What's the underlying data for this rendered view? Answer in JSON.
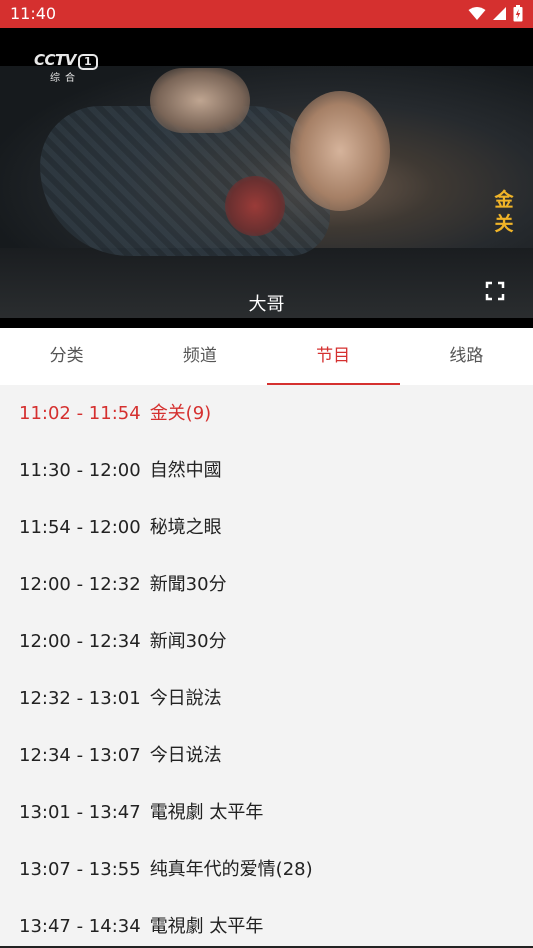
{
  "status_bar": {
    "time": "11:40",
    "background": "#d5302f"
  },
  "player": {
    "channel_logo": {
      "word": "CCTV",
      "number": "1",
      "sub": "综合"
    },
    "overlay_title": [
      "金",
      "关"
    ],
    "caption": "大哥"
  },
  "tabs": [
    {
      "label": "分类",
      "active": false
    },
    {
      "label": "频道",
      "active": false
    },
    {
      "label": "节目",
      "active": true
    },
    {
      "label": "线路",
      "active": false
    }
  ],
  "programs": [
    {
      "time": "11:02 - 11:54",
      "title": "金关(9)",
      "current": true
    },
    {
      "time": "11:30 - 12:00",
      "title": "自然中國",
      "current": false
    },
    {
      "time": "11:54 - 12:00",
      "title": "秘境之眼",
      "current": false
    },
    {
      "time": "12:00 - 12:32",
      "title": "新聞30分",
      "current": false
    },
    {
      "time": "12:00 - 12:34",
      "title": "新闻30分",
      "current": false
    },
    {
      "time": "12:32 - 13:01",
      "title": "今日說法",
      "current": false
    },
    {
      "time": "12:34 - 13:07",
      "title": "今日说法",
      "current": false
    },
    {
      "time": "13:01 - 13:47",
      "title": "電視劇 太平年",
      "current": false
    },
    {
      "time": "13:07 - 13:55",
      "title": "纯真年代的爱情(28)",
      "current": false
    },
    {
      "time": "13:47 - 14:34",
      "title": "電視劇 太平年",
      "current": false
    }
  ],
  "colors": {
    "accent": "#d5302f",
    "overlay_gold": "#f0b428"
  },
  "icons": [
    "wifi-icon",
    "cellular-signal-icon",
    "battery-charging-icon",
    "fullscreen-icon"
  ]
}
